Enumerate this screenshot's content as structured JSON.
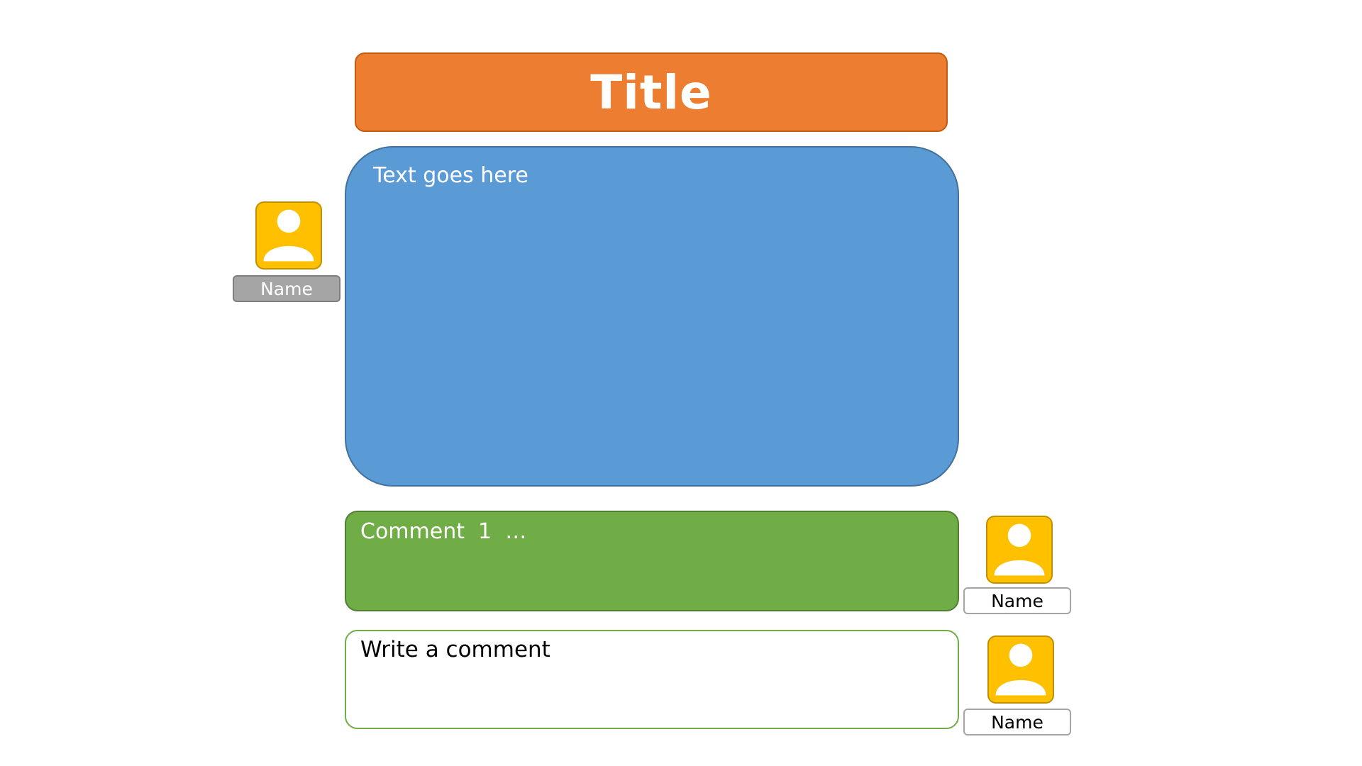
{
  "header": {
    "title": "Title"
  },
  "post": {
    "body_text": "Text goes here",
    "author": {
      "name": "Name",
      "icon": "user-icon"
    }
  },
  "comments": [
    {
      "text": "Comment  1  …",
      "author": {
        "name": "Name",
        "icon": "user-icon"
      }
    }
  ],
  "composer": {
    "placeholder": "Write a comment",
    "author": {
      "name": "Name",
      "icon": "user-icon"
    }
  },
  "colors": {
    "title_bar": "#ed7d31",
    "post_box": "#5b9bd5",
    "comment_box": "#70ad47",
    "avatar": "#ffc000",
    "name_tag_gray": "#a5a5a5"
  }
}
